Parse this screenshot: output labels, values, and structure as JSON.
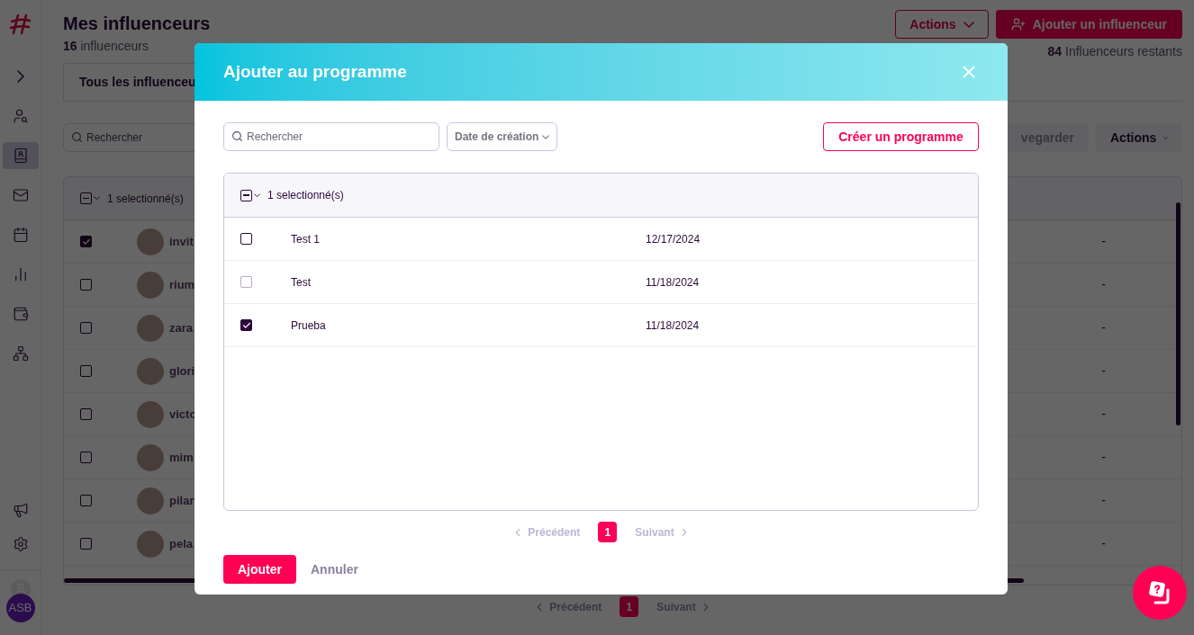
{
  "sidebar": {
    "items": [
      {
        "kind": "expand",
        "selected": false
      },
      {
        "kind": "user-search",
        "selected": false
      },
      {
        "kind": "contacts",
        "selected": true
      },
      {
        "kind": "mail",
        "selected": false
      },
      {
        "kind": "calendar",
        "selected": false
      },
      {
        "kind": "stats",
        "selected": false
      },
      {
        "kind": "wallet",
        "selected": false
      },
      {
        "kind": "network",
        "selected": false
      }
    ],
    "bottom_items": [
      {
        "kind": "megaphone"
      },
      {
        "kind": "settings"
      }
    ],
    "user_initials": "ASB"
  },
  "page": {
    "title": "Mes influenceurs",
    "count": "16",
    "count_label": "influenceurs",
    "actions_button": "Actions",
    "add_button": "Ajouter un influenceur",
    "remaining_count": "84",
    "remaining_label": "Influenceurs restants",
    "tabs": [
      {
        "label": "Tous les influenceu",
        "selected": true
      }
    ],
    "search": {
      "placeholder": "Rechercher"
    },
    "save_button": "vegarder",
    "actions_button_2": "Actions",
    "table": {
      "indeterminate": true,
      "selection": "1 selectionné(s)",
      "rows": [
        {
          "name": "invit",
          "checked": true,
          "column_3": "-"
        },
        {
          "name": "rium",
          "checked": false,
          "column_3": "-"
        },
        {
          "name": "zara",
          "checked": false,
          "column_3": "-"
        },
        {
          "name": "glori",
          "checked": false,
          "column_3": "-"
        },
        {
          "name": "victo",
          "checked": false,
          "column_3": "-"
        },
        {
          "name": "mim",
          "checked": false,
          "column_3": "-"
        },
        {
          "name": "pilar",
          "checked": false,
          "column_3": "-"
        },
        {
          "name": "pela",
          "checked": false,
          "column_3": "-"
        }
      ]
    },
    "pagination": {
      "previous": "Précédent",
      "page": "1",
      "next": "Suivant"
    }
  },
  "dialog": {
    "title": "Ajouter au programme",
    "search": {
      "placeholder": "Rechercher"
    },
    "sort_button": "Date de création",
    "create_button": "Créer un programme",
    "table": {
      "indeterminate": true,
      "selection": "1 selectionné(s)",
      "rows": [
        {
          "name": "Test 1",
          "date": "12/17/2024",
          "checked": false,
          "disabled": false
        },
        {
          "name": "Test",
          "date": "11/18/2024",
          "checked": false,
          "disabled": true
        },
        {
          "name": "Prueba",
          "date": "11/18/2024",
          "checked": true,
          "disabled": false
        }
      ]
    },
    "pagination": {
      "previous": "Précédent",
      "page": "1",
      "next": "Suivant"
    },
    "confirm_button": "Ajouter",
    "cancel_button": "Annuler"
  }
}
